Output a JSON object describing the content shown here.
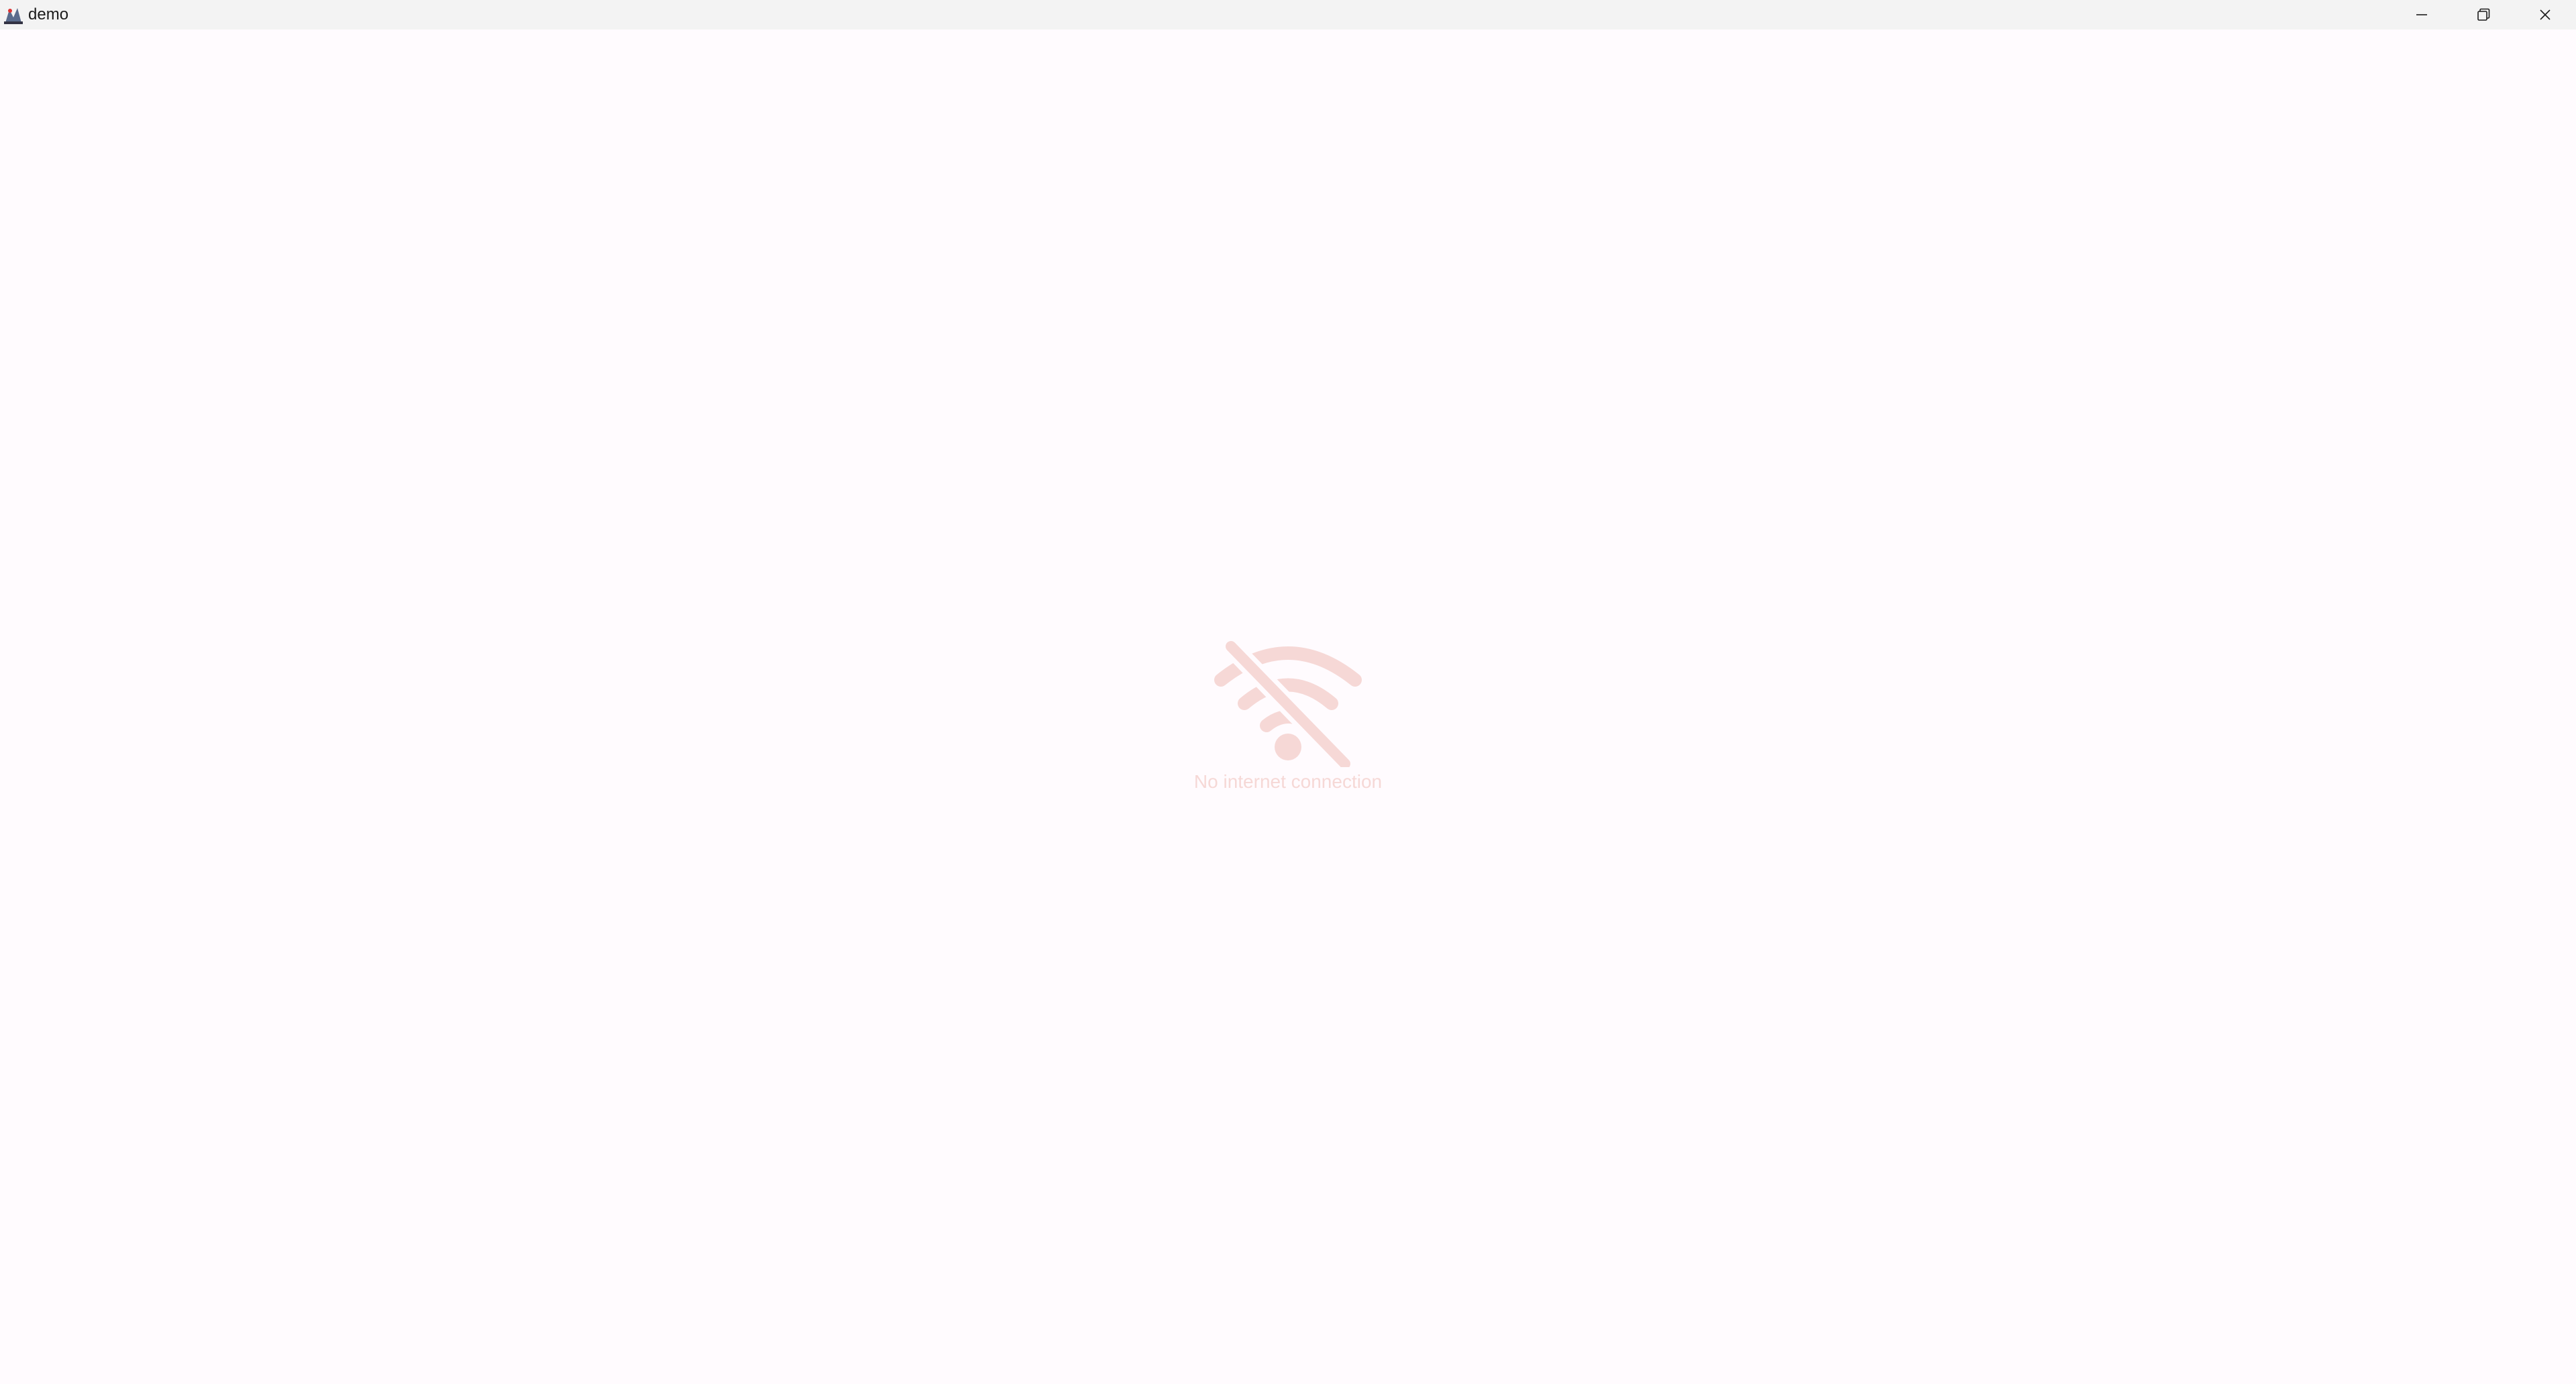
{
  "window": {
    "title": "demo",
    "app_icon": "java-duke-icon",
    "controls": {
      "minimize_icon": "minimize-icon",
      "restore_icon": "restore-icon",
      "close_icon": "close-icon"
    }
  },
  "main": {
    "status_icon": "wifi-off-icon",
    "status_text": "No internet connection",
    "accent_color": "#f6d8d6",
    "background_color": "#fffbfe"
  }
}
